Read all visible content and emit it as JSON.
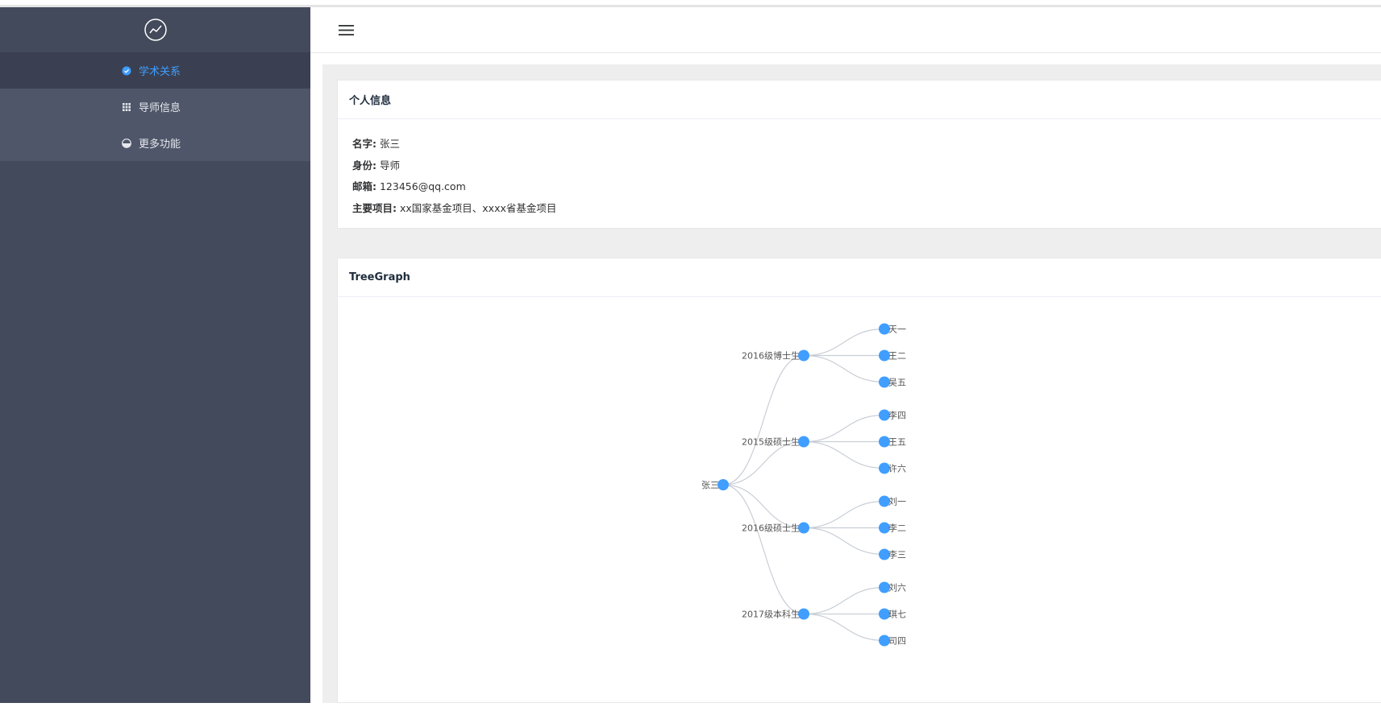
{
  "sidebar": {
    "logo_icon": "trend-chart-icon",
    "items": [
      {
        "label": "学术关系",
        "icon": "check-circle-icon",
        "active": true
      },
      {
        "label": "导师信息",
        "icon": "grid-icon",
        "active": false
      },
      {
        "label": "更多功能",
        "icon": "pie-icon",
        "active": false
      }
    ]
  },
  "header": {
    "menu_icon": "hamburger-icon"
  },
  "profile": {
    "title": "个人信息",
    "name_label": "名字:",
    "name_value": "张三",
    "role_label": "身份:",
    "role_value": "导师",
    "email_label": "邮箱:",
    "email_value": "123456@qq.com",
    "projects_label": "主要项目:",
    "projects_value": "xx国家基金项目、xxxx省基金项目"
  },
  "graph": {
    "title": "TreeGraph",
    "node_color": "#409eff",
    "link_color": "#c9ced6",
    "tree": {
      "name": "张三",
      "children": [
        {
          "name": "2016级博士生",
          "children": [
            {
              "name": "天一"
            },
            {
              "name": "王二"
            },
            {
              "name": "吴五"
            }
          ]
        },
        {
          "name": "2015级硕士生",
          "children": [
            {
              "name": "李四"
            },
            {
              "name": "王五"
            },
            {
              "name": "许六"
            }
          ]
        },
        {
          "name": "2016级硕士生",
          "children": [
            {
              "name": "刘一"
            },
            {
              "name": "李二"
            },
            {
              "name": "李三"
            }
          ]
        },
        {
          "name": "2017级本科生",
          "children": [
            {
              "name": "刘六"
            },
            {
              "name": "琪七"
            },
            {
              "name": "司四"
            }
          ]
        }
      ]
    }
  }
}
